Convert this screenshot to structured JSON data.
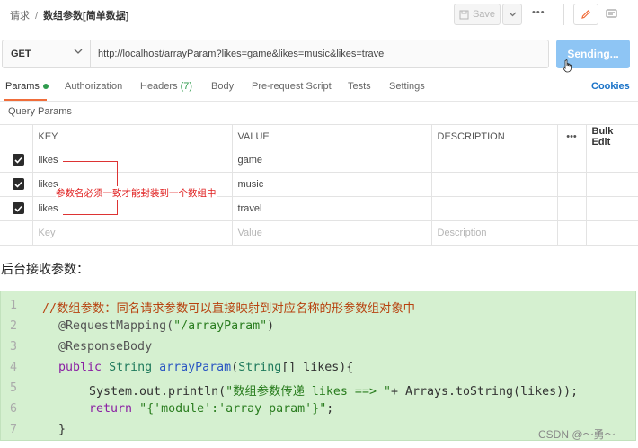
{
  "topbar": {
    "breadcrumb_parent": "请求",
    "breadcrumb_sep": "/",
    "breadcrumb_current": "数组参数[简单数据]",
    "save_label": "Save",
    "more_label": "•••"
  },
  "request": {
    "method": "GET",
    "url": "http://localhost/arrayParam?likes=game&likes=music&likes=travel",
    "send_label": "Sending..."
  },
  "tabs": {
    "params": "Params",
    "authorization": "Authorization",
    "headers": "Headers",
    "headers_count": "(7)",
    "body": "Body",
    "prerequest": "Pre-request Script",
    "tests": "Tests",
    "settings": "Settings",
    "cookies": "Cookies"
  },
  "query_params": {
    "title": "Query Params",
    "headers": {
      "key": "KEY",
      "value": "VALUE",
      "description": "DESCRIPTION",
      "more": "•••",
      "bulk_edit": "Bulk Edit"
    },
    "rows": [
      {
        "key": "likes",
        "value": "game",
        "description": "",
        "checked": true
      },
      {
        "key": "likes",
        "value": "music",
        "description": "",
        "checked": true
      },
      {
        "key": "likes",
        "value": "travel",
        "description": "",
        "checked": true
      }
    ],
    "placeholder": {
      "key": "Key",
      "value": "Value",
      "description": "Description"
    }
  },
  "annotation": "参数名必须一致才能封装到一个数组中",
  "section_title": "后台接收参数：",
  "code": {
    "line_numbers": [
      "1",
      "2",
      "3",
      "4",
      "5",
      "6",
      "7"
    ],
    "comment": "//数组参数：同名请求参数可以直接映射到对应名称的形参数组对象中",
    "mapping_annotation": "@RequestMapping(",
    "mapping_path": "\"/arrayParam\"",
    "mapping_close": ")",
    "response_body": "@ResponseBody",
    "kw_public": "public",
    "type_string": "String",
    "method_name": "arrayParam",
    "param_open": "(",
    "param_type": "String",
    "param_rest": "[] likes){",
    "println_prefix": "System.out.println(",
    "println_str": "\"数组参数传递 likes ==> \"",
    "println_rest": "+ Arrays.toString(likes));",
    "kw_return": "return",
    "return_str": "\"{'module':'array param'}\"",
    "return_end": ";",
    "closing": "}"
  },
  "watermark": "CSDN @～勇～",
  "colors": {
    "send_button": "#8ec5f4",
    "accent_orange": "#f06d3a",
    "code_bg": "#d5f0d0",
    "annotation_red": "#e02020"
  }
}
